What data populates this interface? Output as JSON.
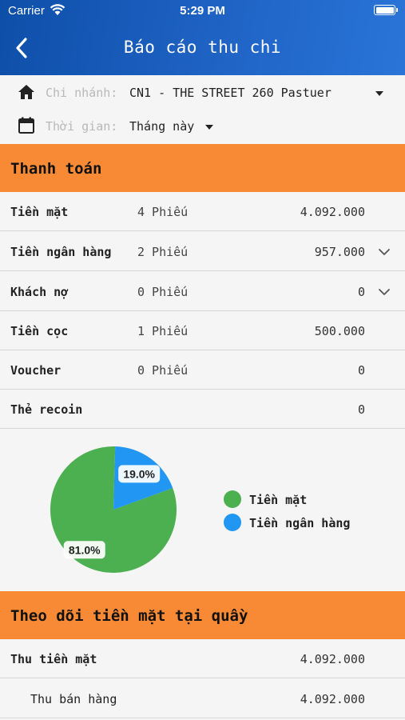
{
  "status_bar": {
    "carrier": "Carrier",
    "time": "5:29 PM"
  },
  "header": {
    "title": "Báo cáo thu chi"
  },
  "filters": {
    "branch_label": "Chi nhánh:",
    "branch_value": "CN1 - THE STREET 260 Pastuer",
    "time_label": "Thời gian:",
    "time_value": "Tháng này"
  },
  "payment": {
    "title": "Thanh toán",
    "rows": [
      {
        "label": "Tiền mặt",
        "count": "4 Phiếu",
        "amount": "4.092.000",
        "expandable": false
      },
      {
        "label": "Tiền ngân hàng",
        "count": "2 Phiếu",
        "amount": "957.000",
        "expandable": true
      },
      {
        "label": "Khách nợ",
        "count": "0 Phiếu",
        "amount": "0",
        "expandable": true
      },
      {
        "label": "Tiền cọc",
        "count": "1 Phiếu",
        "amount": "500.000",
        "expandable": false
      },
      {
        "label": "Voucher",
        "count": "0 Phiếu",
        "amount": "0",
        "expandable": false
      },
      {
        "label": "Thẻ recoin",
        "count": "",
        "amount": "0",
        "expandable": false
      }
    ]
  },
  "chart_data": {
    "type": "pie",
    "series": [
      {
        "name": "Tiền mặt",
        "value": 81.0,
        "label": "81.0%",
        "color": "#4caf50"
      },
      {
        "name": "Tiền ngân hàng",
        "value": 19.0,
        "label": "19.0%",
        "color": "#2196f3"
      }
    ]
  },
  "cash_tracking": {
    "title": "Theo dõi tiền mặt tại quầy",
    "rows": [
      {
        "label": "Thu tiền mặt",
        "amount": "4.092.000"
      },
      {
        "label": "Thu bán hàng",
        "amount": "4.092.000"
      }
    ]
  },
  "colors": {
    "header": "#1f63c5",
    "section": "#f88a35"
  }
}
